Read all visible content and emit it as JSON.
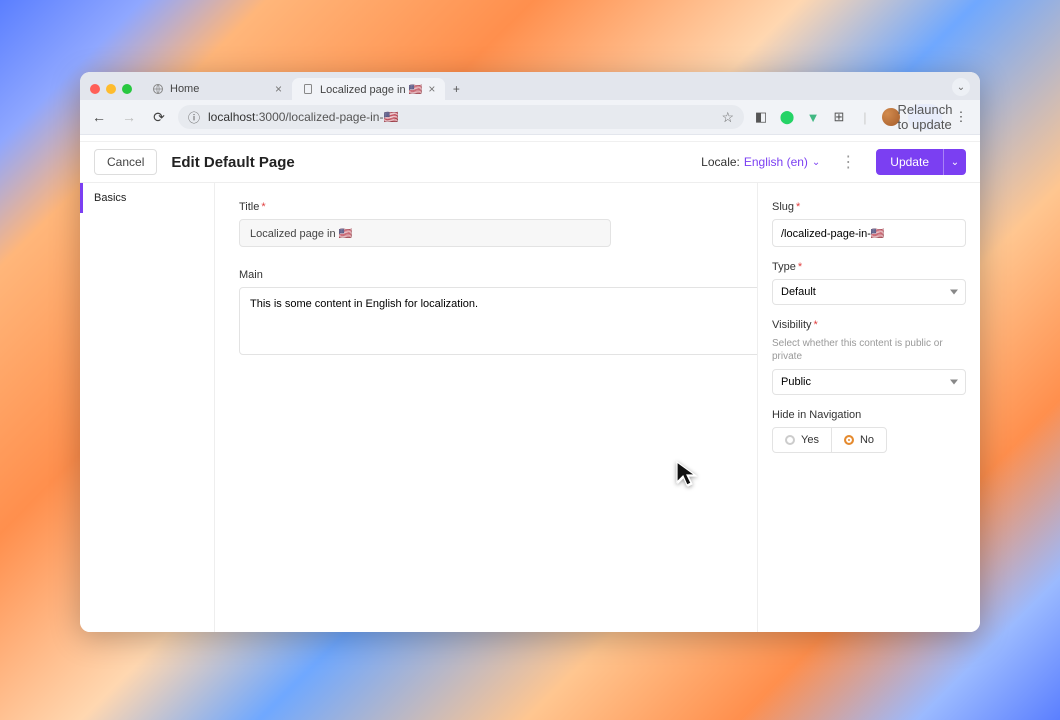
{
  "browser": {
    "tabs": [
      {
        "label": "Home"
      },
      {
        "label": "Localized page in 🇺🇸"
      }
    ],
    "url_host": "localhost",
    "url_port": ":3000",
    "url_path": "/localized-page-in-🇺🇸",
    "relaunch": "Relaunch to update"
  },
  "header": {
    "cancel": "Cancel",
    "title": "Edit Default Page",
    "locale_label": "Locale:",
    "locale_value": "English (en)",
    "update": "Update"
  },
  "sidebar": {
    "items": [
      {
        "label": "Basics"
      }
    ]
  },
  "fields": {
    "title_label": "Title",
    "title_value": "Localized page in 🇺🇸",
    "main_label": "Main",
    "main_value": "This is some content in English for localization."
  },
  "aside": {
    "slug_label": "Slug",
    "slug_value": "/localized-page-in-🇺🇸",
    "type_label": "Type",
    "type_value": "Default",
    "visibility_label": "Visibility",
    "visibility_help": "Select whether this content is public or private",
    "visibility_value": "Public",
    "hidenav_label": "Hide in Navigation",
    "hidenav_yes": "Yes",
    "hidenav_no": "No",
    "hidenav_selected": "No"
  }
}
